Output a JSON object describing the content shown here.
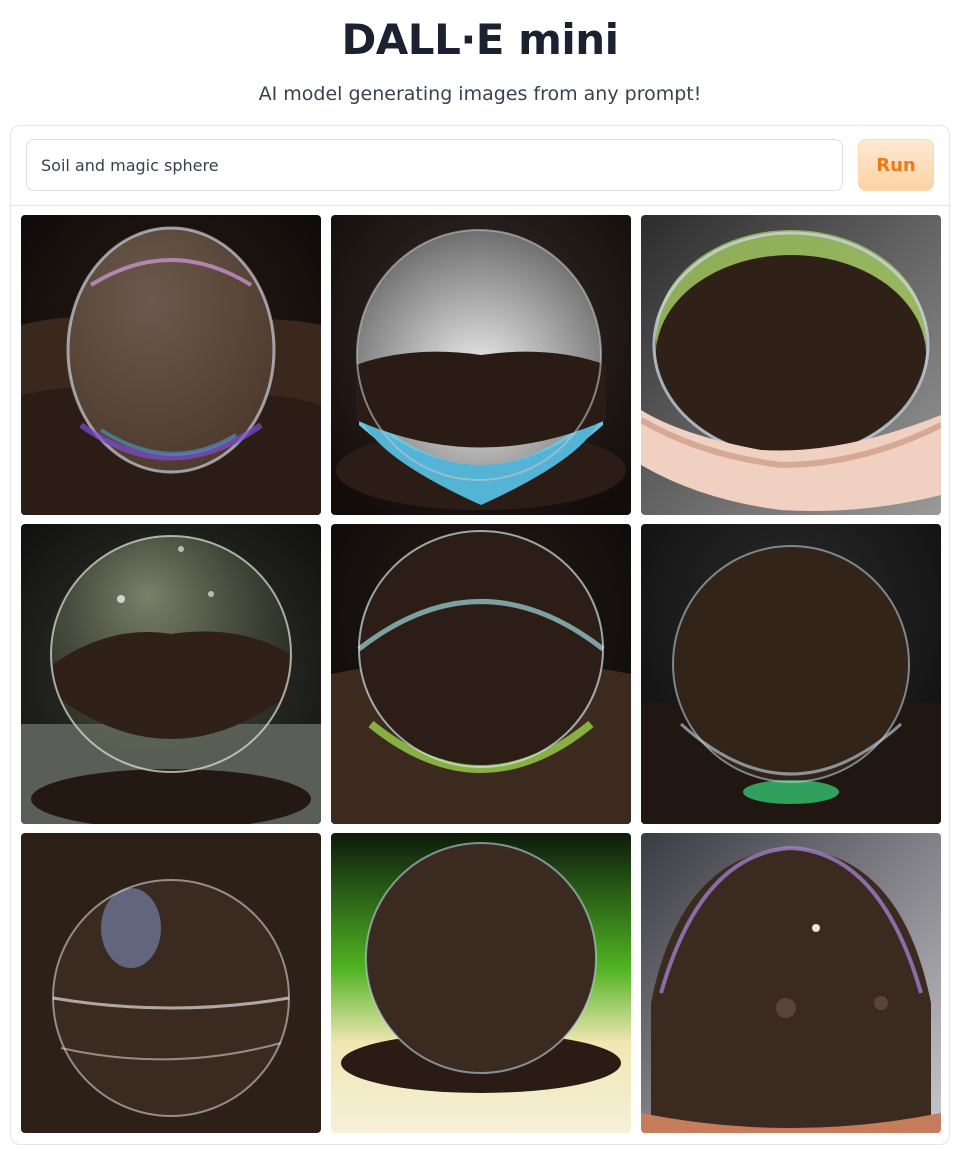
{
  "header": {
    "title": "DALL·E mini",
    "subtitle": "AI model generating images from any prompt!"
  },
  "prompt": {
    "value": "Soil and magic sphere",
    "placeholder": ""
  },
  "run_button": {
    "label": "Run"
  },
  "colors": {
    "accent": "#ee7a14",
    "button_bg": "#fdd2a4",
    "soil": "#2e2119"
  }
}
